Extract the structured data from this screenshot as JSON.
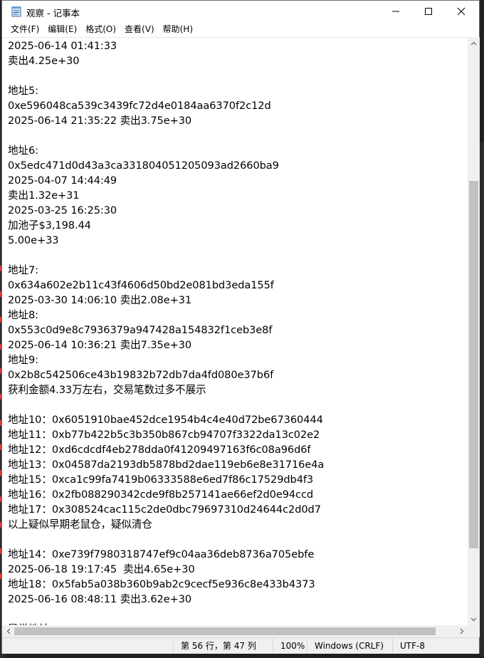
{
  "window": {
    "title": "观察 - 记事本",
    "icon": "notepad-icon"
  },
  "menu": [
    {
      "label": "文件(F)"
    },
    {
      "label": "编辑(E)"
    },
    {
      "label": "格式(O)"
    },
    {
      "label": "查看(V)"
    },
    {
      "label": "帮助(H)"
    }
  ],
  "document": {
    "lines": [
      "2025-06-14 01:41:33",
      "卖出4.25e+30",
      "",
      "地址5:",
      "0xe596048ca539c3439fc72d4e0184aa6370f2c12d",
      "2025-06-14 21:35:22 卖出3.75e+30",
      "",
      "地址6:",
      "0x5edc471d0d43a3ca331804051205093ad2660ba9",
      "2025-04-07 14:44:49",
      "卖出1.32e+31",
      "2025-03-25 16:25:30",
      "加池子$3,198.44",
      "5.00e+33",
      "",
      "地址7:",
      "0x634a602e2b11c43f4606d50bd2e081bd3eda155f",
      "2025-03-30 14:06:10 卖出2.08e+31",
      "地址8:",
      "0x553c0d9e8c7936379a947428a154832f1ceb3e8f",
      "2025-06-14 10:36:21 卖出7.35e+30",
      "地址9:",
      "0x2b8c542506ce43b19832b72db7da4fd080e37b6f",
      "获利金额4.33万左右，交易笔数过多不展示",
      "",
      "地址10：0x6051910bae452dce1954b4c4e40d72be67360444",
      "地址11：0xb77b422b5c3b350b867cb94707f3322da13c02e2",
      "地址12：0xd6cdcdf4eb278dda0f41209497163f6c08a96d6f",
      "地址13：0x04587da2193db5878bd2dae119eb6e8e31716e4a",
      "地址15：0xca1c99fa7419b06333588e6ed7f86c17529db4f3",
      "地址16：0x2fb088290342cde9f8b257141ae66ef2d0e94ccd",
      "地址17：0x308524cac115c2de0dbc79697310d24644c2d0d7",
      "以上疑似早期老鼠仓，疑似清仓",
      "",
      "地址14：0xe739f7980318747ef9c04aa36deb8736a705ebfe",
      "2025-06-18 19:17:45  卖出4.65e+30",
      "地址18：0x5fab5a038b360b9ab2c9cecf5e936c8e433b4373",
      "2025-06-16 08:48:11 卖出3.62e+30",
      "",
      "异常地址"
    ]
  },
  "statusbar": {
    "position": "第 56 行，第 47 列",
    "zoom": "100%",
    "line_ending": "Windows (CRLF)",
    "encoding": "UTF-8"
  }
}
